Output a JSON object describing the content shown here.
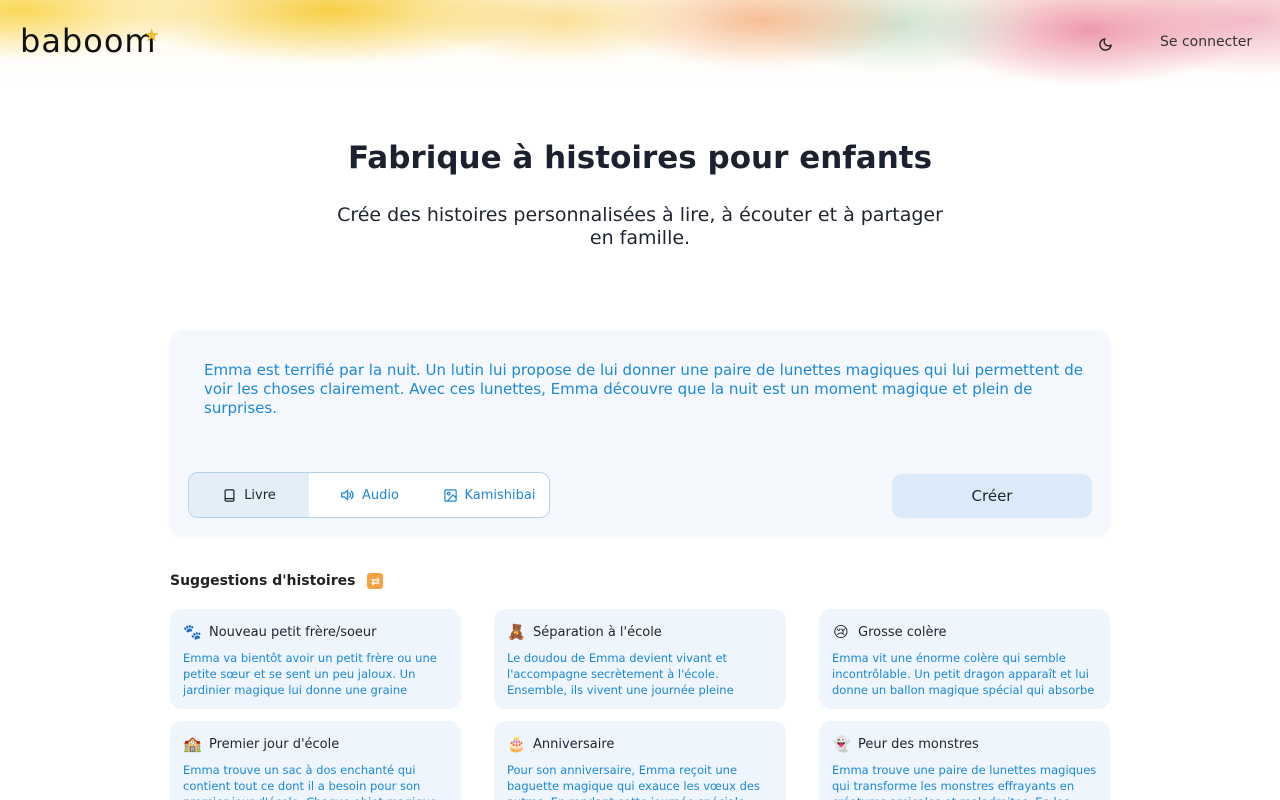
{
  "header": {
    "logo": "baboom",
    "login": "Se connecter",
    "theme_icon": "moon-icon"
  },
  "hero": {
    "title": "Fabrique à histoires pour enfants",
    "subtitle": "Crée des histoires personnalisées à lire, à écouter et à partager en famille."
  },
  "composer": {
    "story": "Emma est terrifié par la nuit. Un lutin lui propose de lui donner une paire de lunettes magiques qui lui permettent de voir les choses clairement. Avec ces lunettes, Emma découvre que la nuit est un moment magique et plein de surprises.",
    "modes": [
      {
        "label": "Livre",
        "icon": "book-icon",
        "active": true
      },
      {
        "label": "Audio",
        "icon": "speaker-icon",
        "active": false
      },
      {
        "label": "Kamishibai",
        "icon": "image-icon",
        "active": false
      }
    ],
    "create_label": "Créer"
  },
  "suggestions": {
    "title": "Suggestions d'histoires",
    "shuffle_icon": "shuffle-icon",
    "items": [
      {
        "emoji": "🐾",
        "title": "Nouveau petit frère/soeur",
        "text": "Emma va bientôt avoir un petit frère ou une petite sœur et se sent un peu jaloux. Un jardinier magique lui donne une graine spéciale qui"
      },
      {
        "emoji": "🧸",
        "title": "Séparation à l'école",
        "text": "Le doudou de Emma devient vivant et l'accompagne secrètement à l'école. Ensemble, ils vivent une journée pleine d'aventures, aidant"
      },
      {
        "emoji": "😢",
        "title": "Grosse colère",
        "text": "Emma vit une énorme colère qui semble incontrôlable. Un petit dragon apparaît et lui donne un ballon magique spécial qui absorbe la"
      },
      {
        "emoji": "🏫",
        "title": "Premier jour d'école",
        "text": "Emma trouve un sac à dos enchanté qui contient tout ce dont il a besoin pour son premier jour d'école. Chaque objet magique l'aide à surmonter"
      },
      {
        "emoji": "🎂",
        "title": "Anniversaire",
        "text": "Pour son anniversaire, Emma reçoit une baguette magique qui exauce les vœux des autres. En rendant cette journée spéciale pour ses amis et sa"
      },
      {
        "emoji": "👻",
        "title": "Peur des monstres",
        "text": "Emma trouve une paire de lunettes magiques qui transforme les monstres effrayants en créatures amicales et maladroites. En les aidant avec leurs"
      }
    ]
  }
}
